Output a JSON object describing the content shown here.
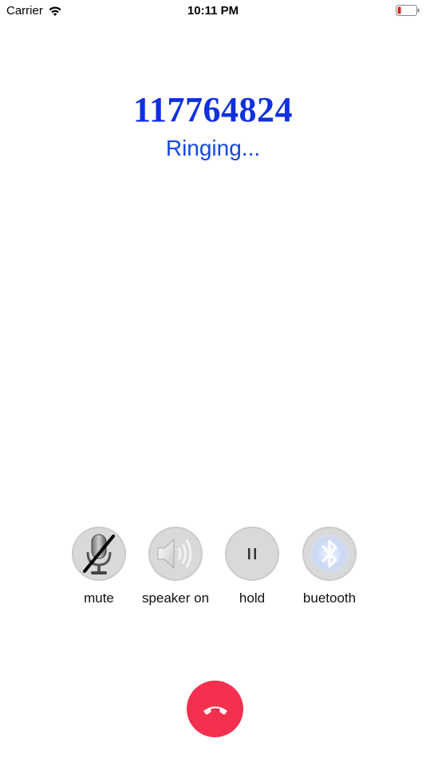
{
  "status_bar": {
    "carrier": "Carrier",
    "time": "10:11 PM",
    "battery_color": "#e02020"
  },
  "call": {
    "number": "117764824",
    "status": "Ringing...",
    "number_color": "#1030e0",
    "status_color": "#1548e6"
  },
  "controls": [
    {
      "label": "mute",
      "icon": "muted-microphone-icon"
    },
    {
      "label": "speaker on",
      "icon": "speaker-icon"
    },
    {
      "label": "hold",
      "icon": "pause-icon"
    },
    {
      "label": "buetooth",
      "icon": "bluetooth-icon"
    }
  ],
  "end_call": {
    "icon": "hang-up-phone-icon",
    "color": "#f4304e"
  }
}
